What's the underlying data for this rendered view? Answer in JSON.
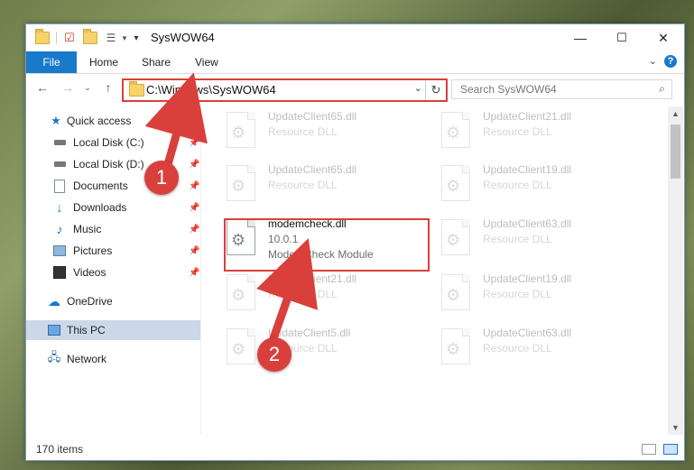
{
  "window": {
    "title": "SysWOW64",
    "controls": {
      "minimize": "—",
      "maximize": "☐",
      "close": "✕"
    }
  },
  "ribbon": {
    "file": "File",
    "tabs": [
      "Home",
      "Share",
      "View"
    ],
    "help": "?"
  },
  "nav": {
    "address": "C:\\Windows\\SysWOW64",
    "search_placeholder": "Search SysWOW64"
  },
  "sidebar": {
    "items": [
      {
        "label": "Quick access",
        "icon": "star-icon"
      },
      {
        "label": "Local Disk (C:)",
        "icon": "drive-icon",
        "pinned": true
      },
      {
        "label": "Local Disk (D:)",
        "icon": "drive-icon",
        "pinned": true
      },
      {
        "label": "Documents",
        "icon": "documents-icon",
        "pinned": true
      },
      {
        "label": "Downloads",
        "icon": "download-icon",
        "pinned": true
      },
      {
        "label": "Music",
        "icon": "music-icon",
        "pinned": true
      },
      {
        "label": "Pictures",
        "icon": "pictures-icon",
        "pinned": true
      },
      {
        "label": "Videos",
        "icon": "videos-icon",
        "pinned": true
      },
      {
        "label": "OneDrive",
        "icon": "cloud-icon"
      },
      {
        "label": "This PC",
        "icon": "computer-icon",
        "selected": true
      },
      {
        "label": "Network",
        "icon": "network-icon"
      }
    ]
  },
  "files": {
    "left": [
      {
        "name": "UpdateClient65.dll",
        "desc": "Resource DLL"
      },
      {
        "name": "UpdateClient65.dll",
        "desc": "Resource DLL"
      },
      {
        "name": "modemcheck.dll",
        "version": "10.0.1",
        "desc": "ModemCheck Module"
      },
      {
        "name": "UpdateClient21.dll",
        "desc": "Resource DLL"
      },
      {
        "name": "UpdateClient5.dll",
        "desc": "Resource DLL"
      }
    ],
    "right": [
      {
        "name": "UpdateClient21.dll",
        "desc": "Resource DLL"
      },
      {
        "name": "UpdateClient19.dll",
        "desc": "Resource DLL"
      },
      {
        "name": "UpdateClient63.dll",
        "desc": "Resource DLL"
      },
      {
        "name": "UpdateClient19.dll",
        "desc": "Resource DLL"
      },
      {
        "name": "UpdateClient63.dll",
        "desc": "Resource DLL"
      }
    ]
  },
  "status": {
    "count": "170 items"
  },
  "annotations": {
    "step1": "1",
    "step2": "2",
    "color": "#d9403b"
  }
}
